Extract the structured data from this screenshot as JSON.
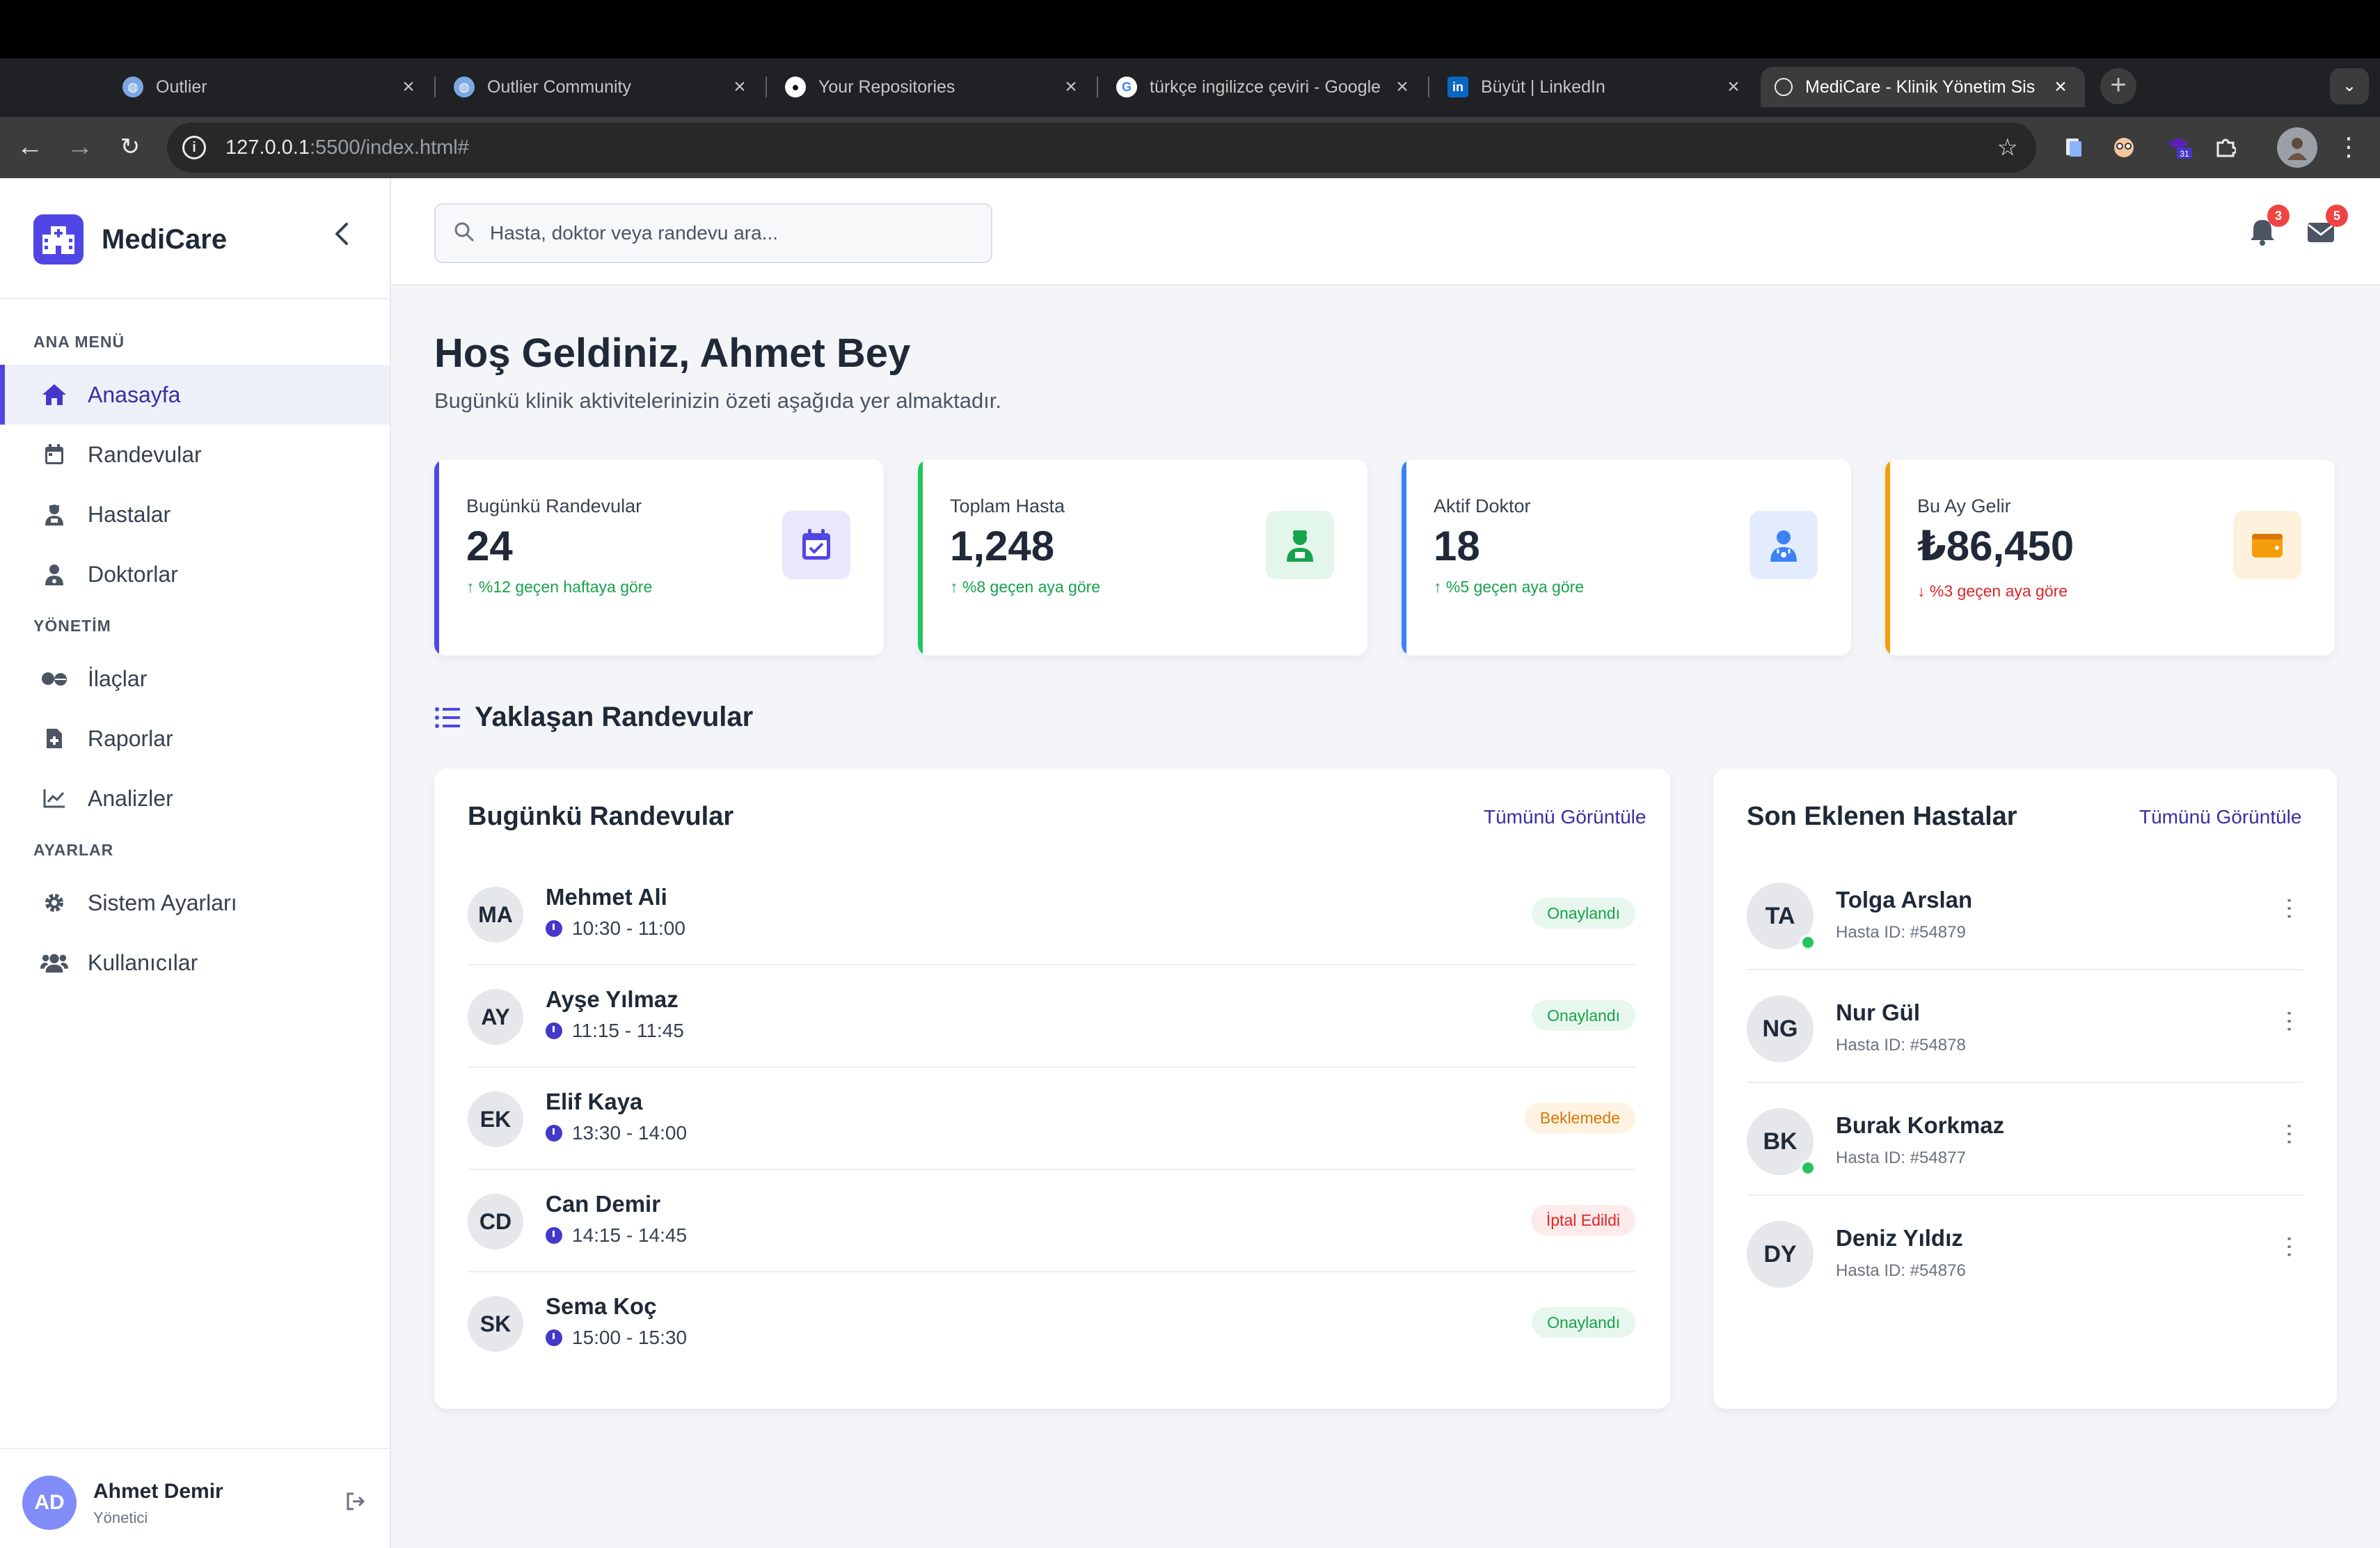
{
  "browser": {
    "tabs": [
      {
        "title": "Outlier",
        "icon": "outlier-icon"
      },
      {
        "title": "Outlier Community",
        "icon": "outlier-icon"
      },
      {
        "title": "Your Repositories",
        "icon": "github-icon"
      },
      {
        "title": "türkçe ingilizce çeviri - Google",
        "icon": "google-icon"
      },
      {
        "title": "Büyüt | LinkedIn",
        "icon": "linkedin-icon"
      },
      {
        "title": "MediCare - Klinik Yönetim Sis",
        "icon": "globe-icon"
      }
    ],
    "url_host": "127.0.0.1",
    "url_rest": ":5500/index.html#",
    "extension_badge": "31"
  },
  "sidebar": {
    "brand": "MediCare",
    "sections": [
      {
        "title": "ANA MENÜ",
        "items": [
          {
            "label": "Anasayfa",
            "icon": "home-icon",
            "active": true
          },
          {
            "label": "Randevular",
            "icon": "calendar-icon"
          },
          {
            "label": "Hastalar",
            "icon": "patient-icon"
          },
          {
            "label": "Doktorlar",
            "icon": "doctor-icon"
          }
        ]
      },
      {
        "title": "YÖNETİM",
        "items": [
          {
            "label": "İlaçlar",
            "icon": "pills-icon"
          },
          {
            "label": "Raporlar",
            "icon": "report-icon"
          },
          {
            "label": "Analizler",
            "icon": "chart-icon"
          }
        ]
      },
      {
        "title": "AYARLAR",
        "items": [
          {
            "label": "Sistem Ayarları",
            "icon": "gear-icon"
          },
          {
            "label": "Kullanıcılar",
            "icon": "users-icon"
          }
        ]
      }
    ],
    "profile": {
      "initials": "AD",
      "name": "Ahmet Demir",
      "role": "Yönetici"
    }
  },
  "header": {
    "search_placeholder": "Hasta, doktor veya randevu ara...",
    "notifications": "3",
    "messages": "5"
  },
  "welcome": {
    "title": "Hoş Geldiniz, Ahmet Bey",
    "subtitle": "Bugünkü klinik aktivitelerinizin özeti aşağıda yer almaktadır."
  },
  "stats": [
    {
      "label": "Bugünkü Randevular",
      "value": "24",
      "change": "%12 geçen haftaya göre",
      "trend": "up",
      "color": "#4f46e5",
      "icon": "calendar-check-icon"
    },
    {
      "label": "Toplam Hasta",
      "value": "1,248",
      "change": "%8 geçen aya göre",
      "trend": "up",
      "color": "#22c55e",
      "icon": "patient-icon"
    },
    {
      "label": "Aktif Doktor",
      "value": "18",
      "change": "%5 geçen aya göre",
      "trend": "up",
      "color": "#3b82f6",
      "icon": "doctor-icon"
    },
    {
      "label": "Bu Ay Gelir",
      "value": "₺86,450",
      "change": "%3 geçen aya göre",
      "trend": "down",
      "color": "#f59e0b",
      "icon": "wallet-icon"
    }
  ],
  "section_title": "Yaklaşan Randevular",
  "appointments": {
    "title": "Bugünkü Randevular",
    "link": "Tümünü Görüntüle",
    "items": [
      {
        "initials": "MA",
        "name": "Mehmet Ali",
        "time": "10:30 - 11:00",
        "status": "Onaylandı",
        "status_type": "ok"
      },
      {
        "initials": "AY",
        "name": "Ayşe Yılmaz",
        "time": "11:15 - 11:45",
        "status": "Onaylandı",
        "status_type": "ok"
      },
      {
        "initials": "EK",
        "name": "Elif Kaya",
        "time": "13:30 - 14:00",
        "status": "Beklemede",
        "status_type": "wait"
      },
      {
        "initials": "CD",
        "name": "Can Demir",
        "time": "14:15 - 14:45",
        "status": "İptal Edildi",
        "status_type": "cancel"
      },
      {
        "initials": "SK",
        "name": "Sema Koç",
        "time": "15:00 - 15:30",
        "status": "Onaylandı",
        "status_type": "ok"
      }
    ]
  },
  "patients": {
    "title": "Son Eklenen Hastalar",
    "link": "Tümünü Görüntüle",
    "items": [
      {
        "initials": "TA",
        "name": "Tolga Arslan",
        "id": "Hasta ID: #54879",
        "online": true
      },
      {
        "initials": "NG",
        "name": "Nur Gül",
        "id": "Hasta ID: #54878",
        "online": false
      },
      {
        "initials": "BK",
        "name": "Burak Korkmaz",
        "id": "Hasta ID: #54877",
        "online": true
      },
      {
        "initials": "DY",
        "name": "Deniz Yıldız",
        "id": "Hasta ID: #54876",
        "online": false
      }
    ]
  }
}
